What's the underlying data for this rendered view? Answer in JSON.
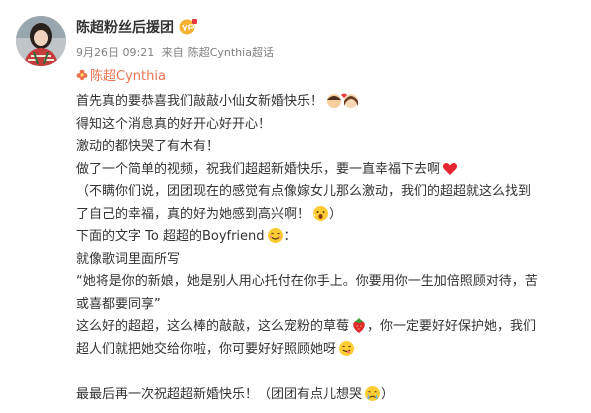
{
  "post": {
    "username": "陈超粉丝后援团",
    "meta": {
      "date": "9月26日 09:21",
      "from_label": "来自",
      "source": "陈超Cynthia超话"
    },
    "mention": "陈超Cynthia",
    "lines": [
      "首先真的要恭喜我们敲敲小仙女新婚快乐！",
      "得知这个消息真的好开心好开心！",
      "激动的都快哭了有木有！",
      "做了一个简单的视频，祝我们超超新婚快乐，要一直幸福下去啊",
      "（不瞒你们说，团团现在的感觉有点像嫁女儿那么激动，我们的超超就这么找到",
      "了自己的幸福，真的好为她感到高兴啊！",
      "下面的文字 To 超超的Boyfriend",
      "就像歌词里面所写",
      "“她将是你的新娘，她是别人用心托付在你手上。你要用你一生加倍照顾对待，苦",
      "或喜都要同享”",
      "这么好的超超，这么棒的敲敲，这么宠粉的草莓",
      "超人们就把她交给你啦，你可要好好照顾她呀",
      "",
      "最最后再一次祝超超新婚快乐！（团团有点儿想哭"
    ],
    "line_suffixes": {
      "line6_end": "）",
      "line7_end": "：",
      "line11_end": "，你一定要好好保护她，我们",
      "line14_end": "）"
    },
    "icons": {
      "avatar": "avatar-image",
      "badge": "vip-badge-icon",
      "mention_prefix": "supertopic-flower-icon"
    },
    "colors": {
      "text": "#333333",
      "meta": "#808080",
      "mention": "#eb7350"
    }
  }
}
